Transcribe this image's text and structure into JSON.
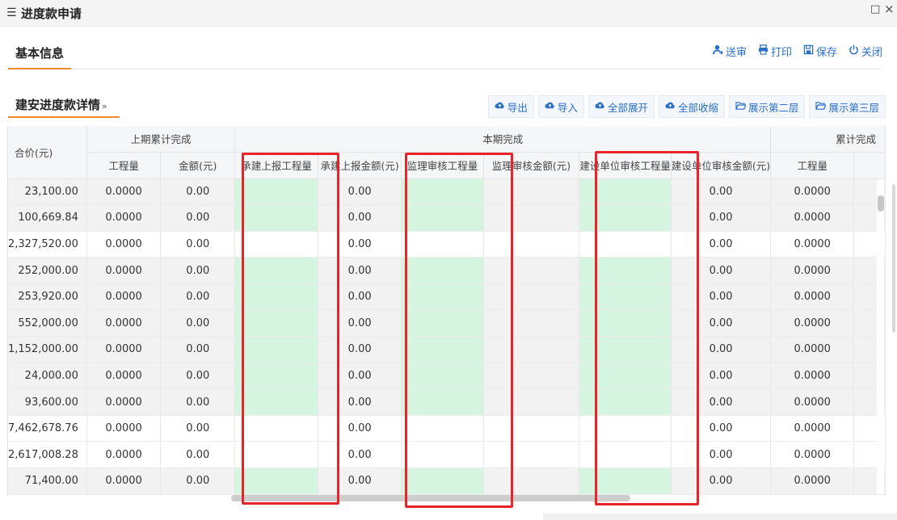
{
  "window": {
    "title": "进度款申请",
    "menu_icon": "hamburger-icon",
    "restore_icon": "□",
    "close_icon": "×"
  },
  "basic_section": {
    "label": "基本信息",
    "actions": [
      {
        "name": "submit-review-button",
        "icon": "user-send-icon",
        "label": "送审"
      },
      {
        "name": "print-button",
        "icon": "printer-icon",
        "label": "打印"
      },
      {
        "name": "save-button",
        "icon": "floppy-icon",
        "label": "保存"
      },
      {
        "name": "close-button",
        "icon": "power-icon",
        "label": "关闭"
      }
    ]
  },
  "detail_section": {
    "label": "建安进度款详情",
    "chevron": "»",
    "buttons": [
      {
        "name": "export-button",
        "icon": "cloud-icon",
        "label": "导出"
      },
      {
        "name": "import-button",
        "icon": "cloud-icon",
        "label": "导入"
      },
      {
        "name": "expand-all-button",
        "icon": "cloud-icon",
        "label": "全部展开"
      },
      {
        "name": "collapse-all-button",
        "icon": "cloud-icon",
        "label": "全部收缩"
      },
      {
        "name": "show-level-2-button",
        "icon": "folder-open-icon",
        "label": "展示第二层"
      },
      {
        "name": "show-level-3-button",
        "icon": "folder-open-icon",
        "label": "展示第三层"
      }
    ]
  },
  "grid": {
    "group_headers": {
      "total_price": "合价(元)",
      "prev_cumulative": "上期累计完成",
      "current_period": "本期完成",
      "cumulative": "累计完成"
    },
    "columns": [
      "工程量",
      "金额(元)",
      "承建上报工程量",
      "承建上报金额(元)",
      "监理审核工程量",
      "监理审核金额(元)",
      "建设单位审核工程量",
      "建设单位审核金额(元)",
      "工程量"
    ],
    "rows": [
      {
        "total": "23,100.00",
        "qty": "0.0000",
        "amt": "0.00",
        "rep_amt": "0.00",
        "owner_amt": "0.00",
        "cum_qty": "0.0000",
        "editable": true
      },
      {
        "total": "100,669.84",
        "qty": "0.0000",
        "amt": "0.00",
        "rep_amt": "0.00",
        "owner_amt": "0.00",
        "cum_qty": "0.0000",
        "editable": true
      },
      {
        "total": "2,327,520.00",
        "qty": "0.0000",
        "amt": "0.00",
        "rep_amt": "0.00",
        "owner_amt": "0.00",
        "cum_qty": "0.0000",
        "editable": false
      },
      {
        "total": "252,000.00",
        "qty": "0.0000",
        "amt": "0.00",
        "rep_amt": "0.00",
        "owner_amt": "0.00",
        "cum_qty": "0.0000",
        "editable": true
      },
      {
        "total": "253,920.00",
        "qty": "0.0000",
        "amt": "0.00",
        "rep_amt": "0.00",
        "owner_amt": "0.00",
        "cum_qty": "0.0000",
        "editable": true
      },
      {
        "total": "552,000.00",
        "qty": "0.0000",
        "amt": "0.00",
        "rep_amt": "0.00",
        "owner_amt": "0.00",
        "cum_qty": "0.0000",
        "editable": true
      },
      {
        "total": "1,152,000.00",
        "qty": "0.0000",
        "amt": "0.00",
        "rep_amt": "0.00",
        "owner_amt": "0.00",
        "cum_qty": "0.0000",
        "editable": true
      },
      {
        "total": "24,000.00",
        "qty": "0.0000",
        "amt": "0.00",
        "rep_amt": "0.00",
        "owner_amt": "0.00",
        "cum_qty": "0.0000",
        "editable": true
      },
      {
        "total": "93,600.00",
        "qty": "0.0000",
        "amt": "0.00",
        "rep_amt": "0.00",
        "owner_amt": "0.00",
        "cum_qty": "0.0000",
        "editable": true
      },
      {
        "total": "7,462,678.76",
        "qty": "0.0000",
        "amt": "0.00",
        "rep_amt": "0.00",
        "owner_amt": "0.00",
        "cum_qty": "0.0000",
        "editable": false
      },
      {
        "total": "2,617,008.28",
        "qty": "0.0000",
        "amt": "0.00",
        "rep_amt": "0.00",
        "owner_amt": "0.00",
        "cum_qty": "0.0000",
        "editable": false
      },
      {
        "total": "71,400.00",
        "qty": "0.0000",
        "amt": "0.00",
        "rep_amt": "0.00",
        "owner_amt": "0.00",
        "cum_qty": "0.0000",
        "editable": true
      }
    ]
  },
  "colors": {
    "accent_blue": "#2a6fc9",
    "tab_underline": "#f08b2c",
    "editable_cell": "#d6f5e0",
    "highlight_red": "#e8232a"
  }
}
